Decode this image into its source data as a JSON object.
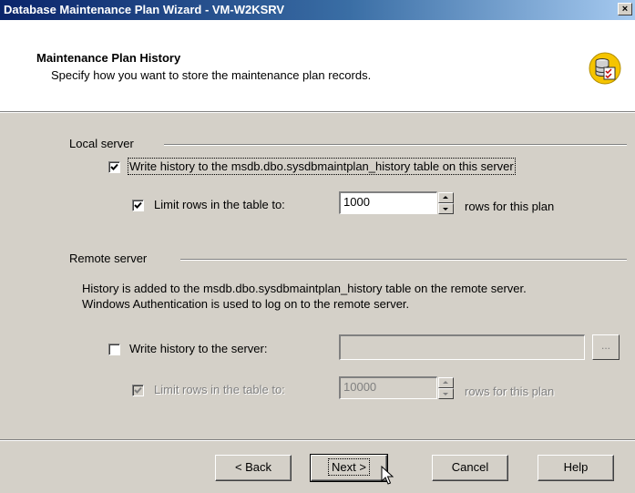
{
  "window": {
    "title": "Database Maintenance Plan Wizard - VM-W2KSRV",
    "close_glyph": "×"
  },
  "header": {
    "title": "Maintenance Plan History",
    "subtitle": "Specify how you want to store the maintenance plan records.",
    "icon": "database-checklist-icon"
  },
  "local_server": {
    "group_label": "Local server",
    "write_history": {
      "label": "Write history to the msdb.dbo.sysdbmaintplan_history table on this server",
      "checked": true
    },
    "limit_rows": {
      "label": "Limit rows in the table to:",
      "checked": true,
      "value": "1000",
      "suffix": "rows for this plan"
    }
  },
  "remote_server": {
    "group_label": "Remote server",
    "description_line1": "History is added to the msdb.dbo.sysdbmaintplan_history table on the remote server.",
    "description_line2": "Windows Authentication is used to log on to the remote server.",
    "write_history": {
      "label": "Write history to the server:",
      "checked": false,
      "server_value": "",
      "browse_label": "..."
    },
    "limit_rows": {
      "label": "Limit rows in the table to:",
      "checked": true,
      "disabled": true,
      "value": "10000",
      "suffix": "rows for this plan"
    }
  },
  "buttons": {
    "back": "< Back",
    "next": "Next >",
    "cancel": "Cancel",
    "help": "Help"
  },
  "colors": {
    "title_bar_start": "#0a246a",
    "title_bar_end": "#a6caf0",
    "dialog_face": "#d4d0c8",
    "disabled_text": "#808080",
    "icon_yellow": "#f5c400"
  }
}
